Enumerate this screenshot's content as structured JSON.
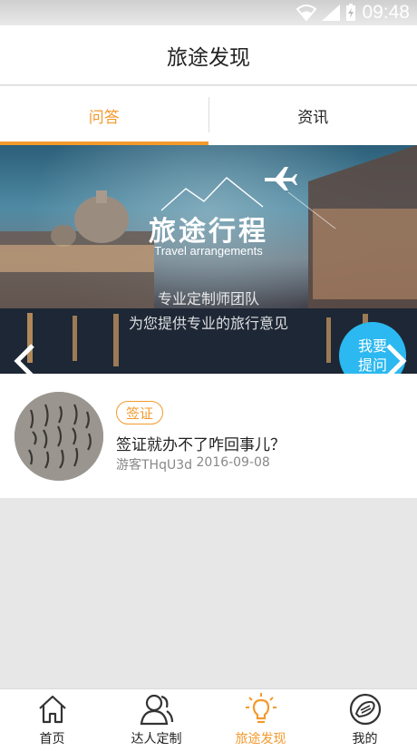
{
  "status_bar": {
    "time": "09:48",
    "icons": [
      "wifi-icon",
      "signal-icon",
      "battery-charging-icon"
    ]
  },
  "header": {
    "title": "旅途发现"
  },
  "tabs": [
    {
      "label": "问答",
      "active": true
    },
    {
      "label": "资讯",
      "active": false
    }
  ],
  "banner": {
    "brand_main": "旅途行程",
    "brand_sub": "Travel arrangements",
    "slogan_line1": "专业定制师团队",
    "slogan_line2": "为您提供专业的旅行意见",
    "ask_button_line1": "我要",
    "ask_button_line2": "提问",
    "icons": [
      "airplane-icon",
      "chevron-left-icon",
      "chevron-right-icon"
    ]
  },
  "qa_items": [
    {
      "tag": "签证",
      "question": "签证就办不了咋回事儿？",
      "author": "游客THqU3d",
      "date": "2016-09-08"
    }
  ],
  "bottom_nav": [
    {
      "label": "首页",
      "icon": "home-icon",
      "active": false
    },
    {
      "label": "达人定制",
      "icon": "users-icon",
      "active": false
    },
    {
      "label": "旅途发现",
      "icon": "lightbulb-icon",
      "active": true
    },
    {
      "label": "我的",
      "icon": "profile-icon",
      "active": false
    }
  ],
  "colors": {
    "accent": "#f39a2c",
    "ask_button": "#2cb8f0",
    "background": "#e7e7e7"
  }
}
